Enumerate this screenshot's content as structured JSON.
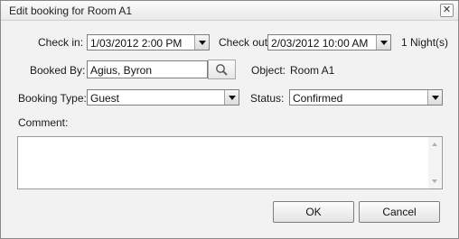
{
  "dialog": {
    "title": "Edit booking for Room A1",
    "close_glyph": "✕"
  },
  "form": {
    "checkin_label": "Check in:",
    "checkin_value": "1/03/2012 2:00 PM",
    "checkout_label": "Check out:",
    "checkout_value": "2/03/2012 10:00 AM",
    "nights": "1 Night(s)",
    "booked_by_label": "Booked By:",
    "booked_by_value": "Agius, Byron",
    "object_label": "Object:",
    "object_value": "Room A1",
    "booking_type_label": "Booking Type:",
    "booking_type_value": "Guest",
    "status_label": "Status:",
    "status_value": "Confirmed",
    "comment_label": "Comment:",
    "comment_value": ""
  },
  "buttons": {
    "ok": "OK",
    "cancel": "Cancel"
  },
  "icons": {
    "search": "search-icon",
    "dropdown": "chevron-down-icon",
    "close": "close-icon"
  }
}
